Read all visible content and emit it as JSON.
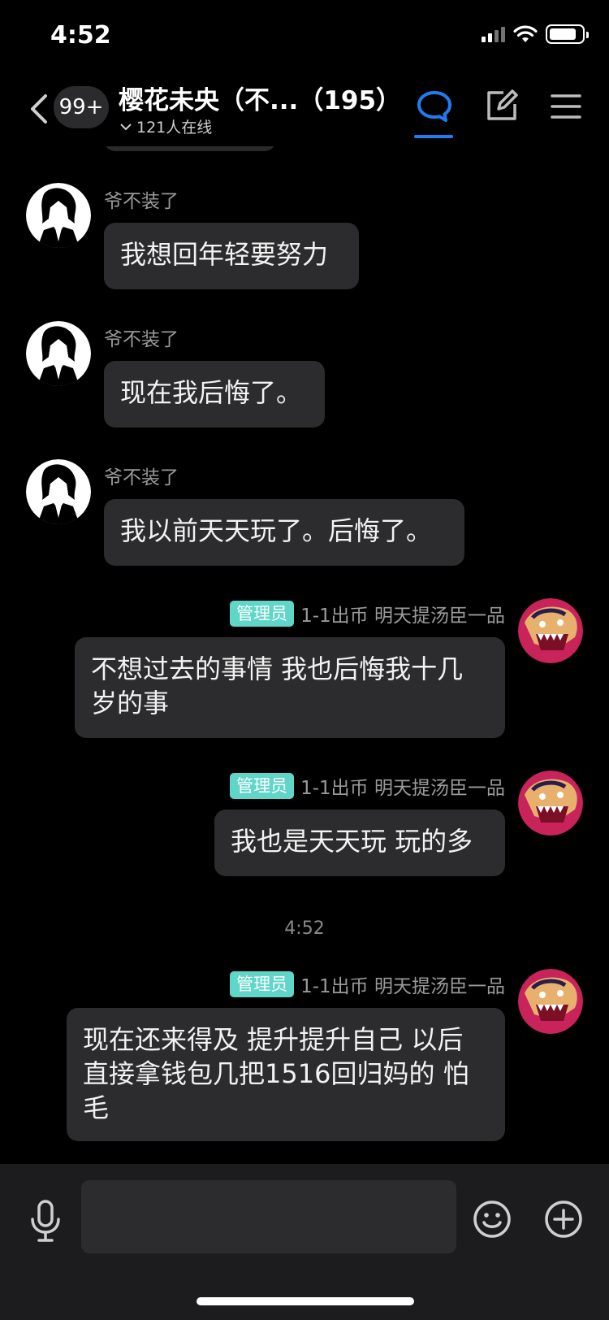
{
  "status_bar": {
    "time": "4:52"
  },
  "nav": {
    "unread_count": "99+",
    "title": "樱花未央（不...（195）",
    "online": "121人在线"
  },
  "messages": [
    {
      "sender": "爷不装了",
      "text": "我想回年轻要努力",
      "avatar": "anime-character-avatar"
    },
    {
      "sender": "爷不装了",
      "text": "现在我后悔了。",
      "avatar": "anime-character-avatar"
    },
    {
      "sender": "爷不装了",
      "text": "我以前天天玩了。后悔了。",
      "avatar": "anime-character-avatar"
    },
    {
      "badge": "管理员",
      "sender": "1-1出币 明天提汤臣一品",
      "text": "不想过去的事情 我也后悔我十几岁的事",
      "avatar": "dragon-avatar"
    },
    {
      "badge": "管理员",
      "sender": "1-1出币 明天提汤臣一品",
      "text": "我也是天天玩 玩的多",
      "avatar": "dragon-avatar"
    },
    {
      "badge": "管理员",
      "sender": "1-1出币 明天提汤臣一品",
      "text": "现在还来得及 提升提升自己 以后直接拿钱包几把1516回归妈的 怕毛",
      "avatar": "dragon-avatar"
    }
  ],
  "time_divider": "4:52",
  "input": {
    "placeholder": ""
  },
  "colors": {
    "accent": "#1f7cf2",
    "admin_badge": "#5fd6c8",
    "bubble": "#2c2c2e",
    "background": "#000000"
  }
}
